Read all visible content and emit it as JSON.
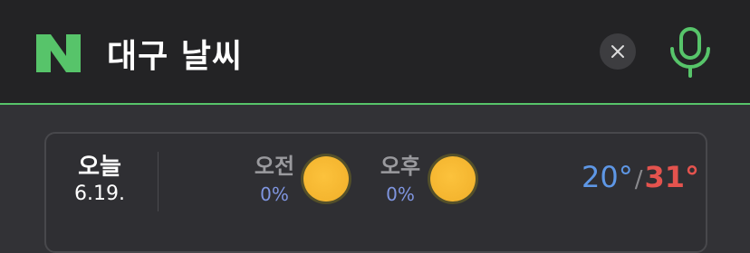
{
  "search": {
    "query": "대구 날씨"
  },
  "colors": {
    "brand_green": "#57c46a",
    "low_temp": "#5e97e6",
    "high_temp": "#e4534e",
    "rain_chance": "#7f95e0"
  },
  "icons": {
    "logo": "naver-n-logo",
    "clear": "close-icon",
    "mic": "microphone-icon",
    "weather": "sunny-icon"
  },
  "weather_card": {
    "day_label": "오늘",
    "date": "6.19.",
    "morning": {
      "label": "오전",
      "rain_chance": "0%",
      "condition_icon": "sunny-icon"
    },
    "afternoon": {
      "label": "오후",
      "rain_chance": "0%",
      "condition_icon": "sunny-icon"
    },
    "low_temp": "20°",
    "separator": "/",
    "high_temp": "31°"
  }
}
